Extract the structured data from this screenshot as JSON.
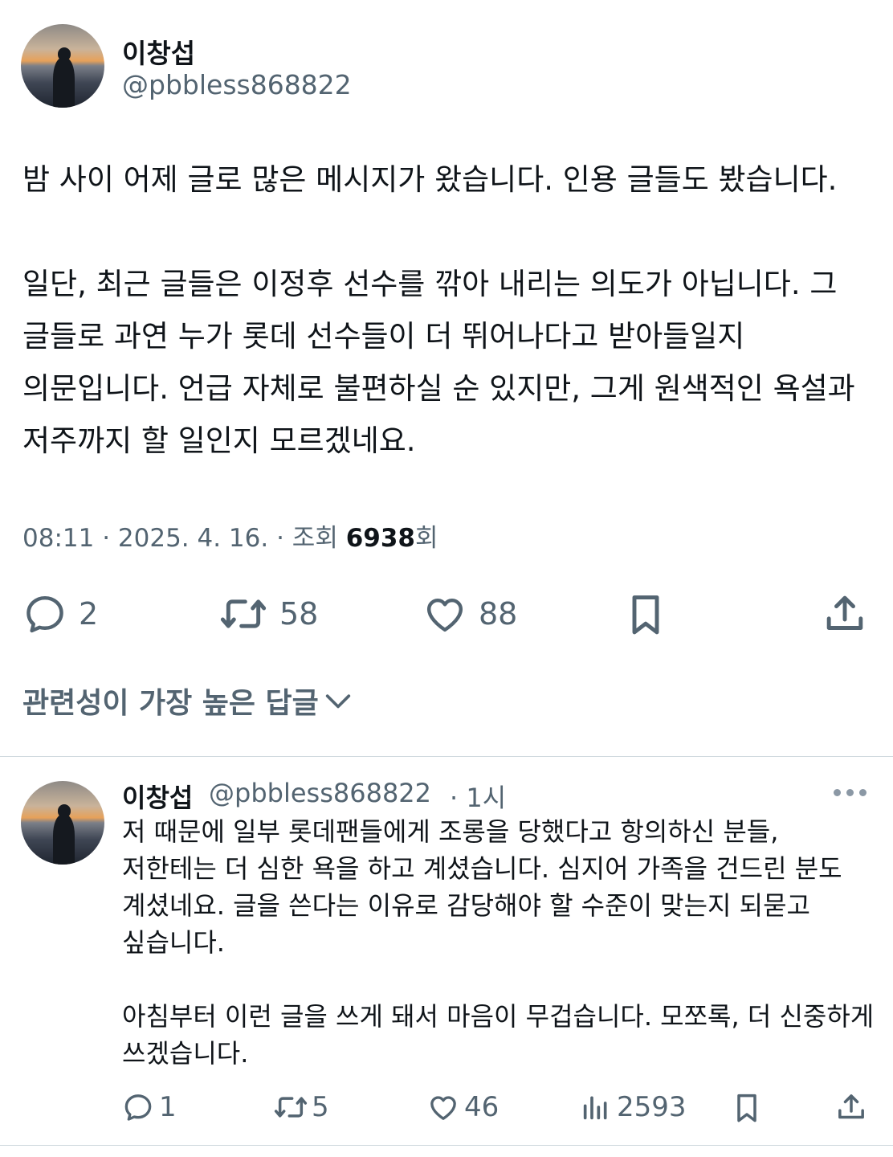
{
  "main_tweet": {
    "author_name": "이창섭",
    "author_handle": "@pbbless868822",
    "paragraph_1": "밤 사이 어제 글로 많은 메시지가 왔습니다. 인용 글들도 봤습니다.",
    "paragraph_2": "일단, 최근 글들은 이정후 선수를 깎아 내리는 의도가 아닙니다. 그 글들로 과연 누가 롯데 선수들이 더 뛰어나다고 받아들일지 의문입니다. 언급 자체로 불편하실 순 있지만, 그게 원색적인 욕설과 저주까지 할 일인지 모르겠네요.",
    "meta_prefix": "08:11 · 2025. 4. 16. · 조회 ",
    "views": "6938",
    "views_suffix": "회",
    "replies": "2",
    "reposts": "58",
    "likes": "88"
  },
  "replies_sort_label": "관련성이 가장 높은 답글",
  "reply_tweet": {
    "author_name": "이창섭",
    "author_handle": "@pbbless868822",
    "time": "· 1시",
    "paragraph_1": "저 때문에 일부 롯데팬들에게 조롱을 당했다고 항의하신 분들, 저한테는 더 심한 욕을 하고 계셨습니다. 심지어 가족을 건드린 분도 계셨네요. 글을 쓴다는 이유로 감당해야 할 수준이 맞는지 되묻고 싶습니다.",
    "paragraph_2": "아침부터 이런 글을 쓰게 돼서 마음이 무겁습니다. 모쪼록, 더 신중하게 쓰겠습니다.",
    "replies": "1",
    "reposts": "5",
    "likes": "46",
    "views": "2593"
  },
  "icons": {
    "reply": "reply-icon",
    "repost": "repost-icon",
    "like": "heart-icon",
    "bookmark": "bookmark-icon",
    "share": "share-icon",
    "views": "analytics-icon",
    "more": "more-icon",
    "chevron": "chevron-down-icon"
  },
  "colors": {
    "text": "#0f1419",
    "secondary": "#536471",
    "divider": "#cfd9de"
  }
}
